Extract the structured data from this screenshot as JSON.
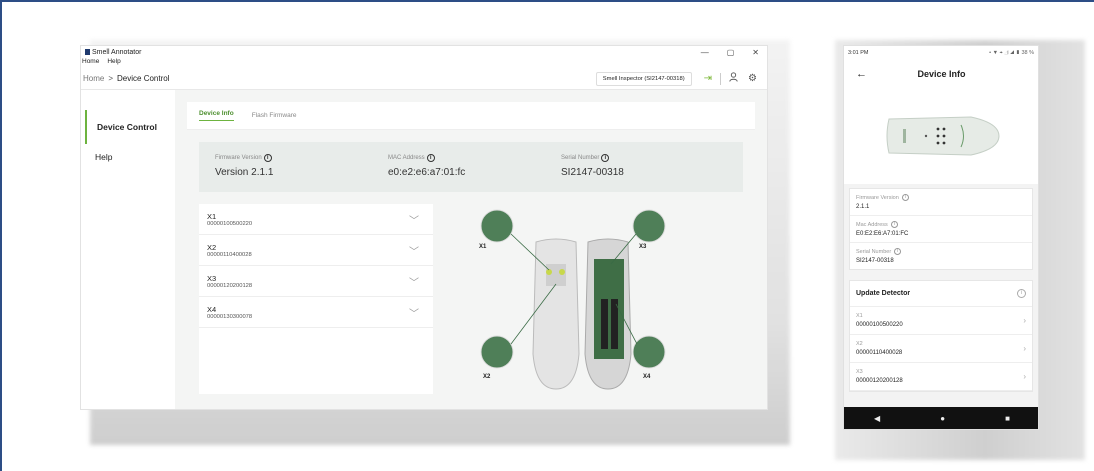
{
  "desktop": {
    "window_title": "Smell Annotator",
    "menu": [
      "Home",
      "Help"
    ],
    "window_controls": {
      "minimize": "—",
      "maximize": "▢",
      "close": "✕"
    },
    "breadcrumb": {
      "root": "Home",
      "separator": ">",
      "current": "Device Control"
    },
    "inspector_label": "Smell Inspector (SI2147-00318)",
    "sidebar": {
      "items": [
        {
          "label": "Device Control",
          "active": true
        },
        {
          "label": "Help",
          "active": false
        }
      ]
    },
    "tabs": [
      {
        "label": "Device Info",
        "active": true
      },
      {
        "label": "Flash Firmware",
        "active": false
      }
    ],
    "info": {
      "firmware": {
        "label": "Firmware Version",
        "value": "Version 2.1.1"
      },
      "mac": {
        "label": "MAC Address",
        "value": "e0:e2:e6:a7:01:fc"
      },
      "serial": {
        "label": "Serial Number",
        "value": "SI2147-00318"
      }
    },
    "detectors": [
      {
        "name": "X1",
        "code": "00000100500220"
      },
      {
        "name": "X2",
        "code": "00000110400028"
      },
      {
        "name": "X3",
        "code": "00000120200128"
      },
      {
        "name": "X4",
        "code": "00000130300078"
      }
    ],
    "figure_labels": {
      "x1": "X1",
      "x2": "X2",
      "x3": "X3",
      "x4": "X4"
    }
  },
  "phone": {
    "time": "3:01 PM",
    "status_icons": "• ▼ ⌖ ◿ ◢ ▮ 38 %",
    "title": "Device Info",
    "firmware": {
      "label": "Firmware Version",
      "value": "2.1.1"
    },
    "mac": {
      "label": "Mac Address",
      "value": "E0:E2:E6:A7:01:FC"
    },
    "serial": {
      "label": "Serial Number",
      "value": "SI2147-00318"
    },
    "update_title": "Update Detector",
    "detectors": [
      {
        "name": "X1",
        "code": "00000100500220"
      },
      {
        "name": "X2",
        "code": "00000110400028"
      },
      {
        "name": "X3",
        "code": "00000120200128"
      }
    ],
    "nav": {
      "back": "◀",
      "home": "●",
      "recent": "■"
    }
  },
  "colors": {
    "accent": "#6db33f",
    "frame": "#2d4e86",
    "info_bg": "#e8ecea"
  }
}
